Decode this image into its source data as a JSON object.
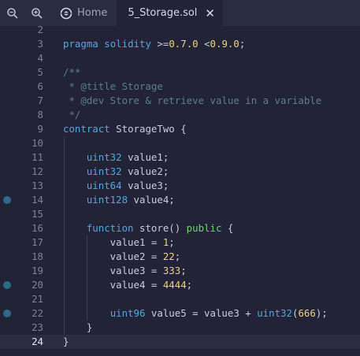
{
  "toolbar": {
    "zoom_out_icon": "zoom-out-icon",
    "zoom_in_icon": "zoom-in-icon"
  },
  "tabs": [
    {
      "label": "Home",
      "icon": "remix-logo-icon",
      "active": false
    },
    {
      "label": "5_Storage.sol",
      "icon": "solidity-file-icon",
      "active": true,
      "close": "✕"
    }
  ],
  "editor": {
    "current_line": 24,
    "lines": [
      {
        "n": "2",
        "text": ""
      },
      {
        "n": "3",
        "text": "pragma solidity >=0.7.0 <0.9.0;"
      },
      {
        "n": "4",
        "text": ""
      },
      {
        "n": "5",
        "text": "/**"
      },
      {
        "n": "6",
        "text": " * @title Storage"
      },
      {
        "n": "7",
        "text": " * @dev Store & retrieve value in a variable"
      },
      {
        "n": "8",
        "text": " */"
      },
      {
        "n": "9",
        "text": "contract StorageTwo {"
      },
      {
        "n": "10",
        "text": ""
      },
      {
        "n": "11",
        "text": "    uint32 value1;"
      },
      {
        "n": "12",
        "text": "    uint32 value2;"
      },
      {
        "n": "13",
        "text": "    uint64 value3;"
      },
      {
        "n": "14",
        "text": "    uint128 value4;"
      },
      {
        "n": "15",
        "text": ""
      },
      {
        "n": "16",
        "text": "    function store() public {"
      },
      {
        "n": "17",
        "text": "        value1 = 1;"
      },
      {
        "n": "18",
        "text": "        value2 = 22;"
      },
      {
        "n": "19",
        "text": "        value3 = 333;"
      },
      {
        "n": "20",
        "text": "        value4 = 4444;"
      },
      {
        "n": "21",
        "text": ""
      },
      {
        "n": "22",
        "text": "        uint96 value5 = value3 + uint32(666);"
      },
      {
        "n": "23",
        "text": "    }"
      },
      {
        "n": "24",
        "text": "}"
      }
    ],
    "breakpoint_lines": [
      "14",
      "20",
      "22"
    ]
  },
  "colors": {
    "background": "#222336",
    "keyword": "#4fa8dd",
    "visibility": "#6bd46b",
    "number": "#e6d57a",
    "comment": "#5a7e90",
    "breakpoint": "#2c6a88"
  }
}
